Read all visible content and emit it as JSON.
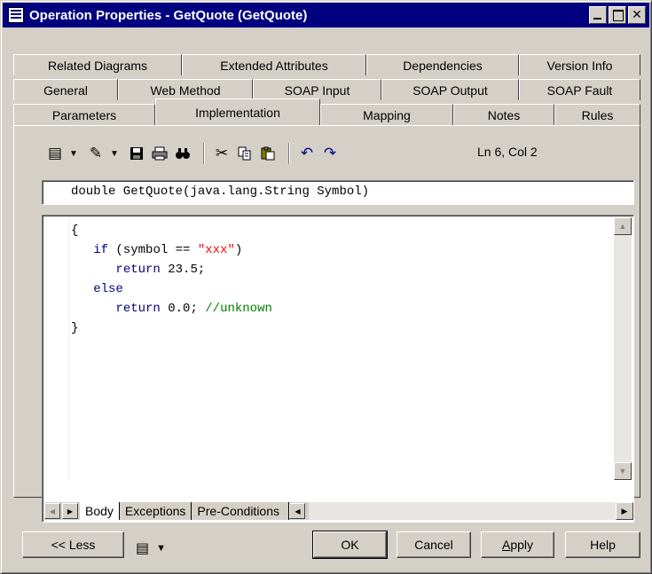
{
  "window": {
    "title": "Operation Properties - GetQuote (GetQuote)"
  },
  "tabs": {
    "row1": [
      "Related Diagrams",
      "Extended Attributes",
      "Dependencies",
      "Version Info"
    ],
    "row2": [
      "General",
      "Web Method",
      "SOAP Input",
      "SOAP Output",
      "SOAP Fault"
    ],
    "row3": [
      "Parameters",
      "Implementation",
      "Mapping",
      "Notes",
      "Rules"
    ],
    "active": "Implementation"
  },
  "toolbar": {
    "icons": [
      "properties-icon",
      "edit-icon",
      "save-icon",
      "print-icon",
      "find-icon",
      "cut-icon",
      "copy-icon",
      "paste-icon",
      "undo-icon",
      "redo-icon"
    ],
    "position": "Ln 6, Col 2"
  },
  "signature": "double GetQuote(java.lang.String Symbol)",
  "code": {
    "line1": "{",
    "line2_kw": "if",
    "line2_a": " (symbol == ",
    "line2_str": "\"xxx\"",
    "line2_b": ")",
    "line3_kw": "return",
    "line3_b": " 23.5;",
    "line4_kw": "else",
    "line5_kw": "return",
    "line5_b": " 0.0; ",
    "line5_cmt": "//unknown",
    "line6": "}"
  },
  "bottom_tabs": [
    "Body",
    "Exceptions",
    "Pre-Conditions"
  ],
  "buttons": {
    "less": "<< Less",
    "ok": "OK",
    "cancel": "Cancel",
    "apply": "Apply",
    "help": "Help"
  }
}
